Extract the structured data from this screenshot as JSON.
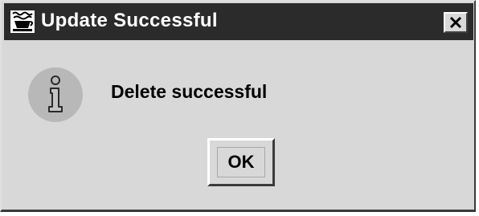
{
  "window": {
    "title": "Update Successful",
    "title_icon": "coffee-cup-icon",
    "close_icon": "close-icon"
  },
  "dialog": {
    "icon": "information-icon",
    "message": "Delete successful",
    "ok_label": "OK"
  },
  "colors": {
    "titlebar_bg": "#2b2b2b",
    "title_text": "#ffffff",
    "dialog_bg": "#d8d8d8",
    "info_icon_circle": "#b8b8b8"
  }
}
